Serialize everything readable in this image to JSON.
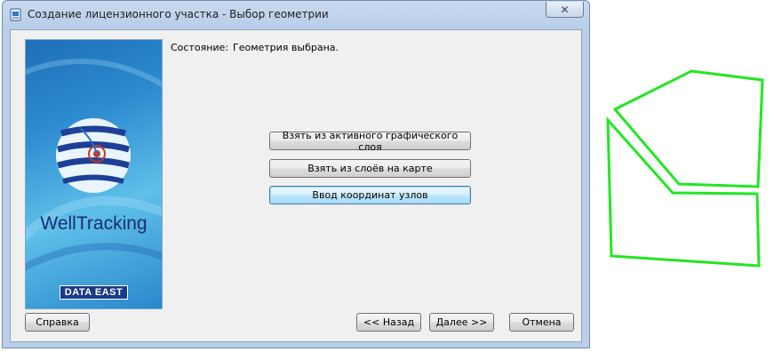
{
  "window": {
    "title": "Создание лицензионного участка - Выбор геометрии",
    "close_glyph": "✕"
  },
  "banner": {
    "brand": "WellTracking",
    "vendor": "DATA EAST"
  },
  "status": {
    "label": "Состояние:",
    "value": "Геометрия выбрана."
  },
  "actions": {
    "from_active_layer": "Взять из активного графического слоя",
    "from_map_layers": "Взять из слоёв на карте",
    "enter_coordinates": "Ввод координат узлов"
  },
  "footer": {
    "help": "Справка",
    "back": "<< Назад",
    "next": "Далее >>",
    "cancel": "Отмена"
  },
  "colors": {
    "polygon_outline": "#22e622",
    "window_frame": "#b9cfe9"
  }
}
